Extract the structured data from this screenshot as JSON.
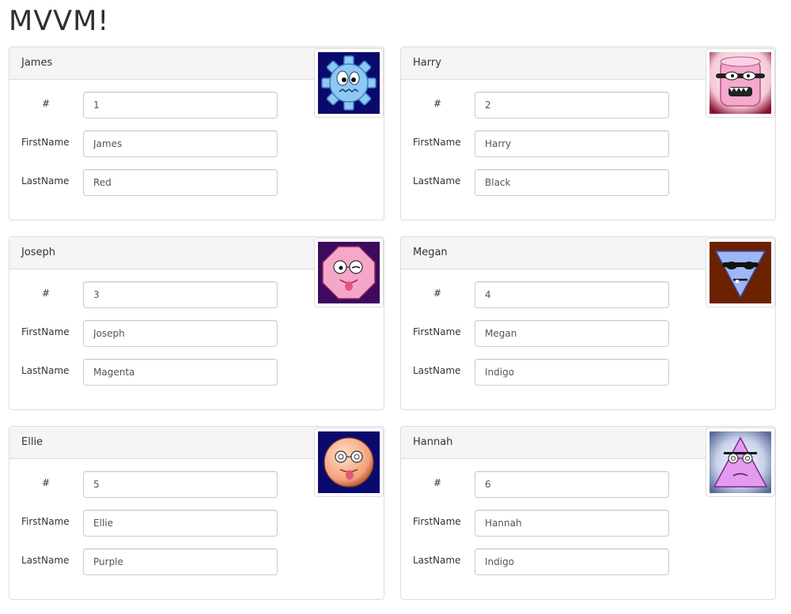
{
  "page": {
    "title": "MVVM!"
  },
  "labels": {
    "id": "#",
    "first": "FirstName",
    "last": "LastName"
  },
  "people": [
    {
      "header": "James",
      "id": "1",
      "first": "James",
      "last": "Red",
      "avatar": "blue-gear-monster-icon"
    },
    {
      "header": "Harry",
      "id": "2",
      "first": "Harry",
      "last": "Black",
      "avatar": "pink-cylinder-monster-icon"
    },
    {
      "header": "Joseph",
      "id": "3",
      "first": "Joseph",
      "last": "Magenta",
      "avatar": "pink-octagon-monster-icon"
    },
    {
      "header": "Megan",
      "id": "4",
      "first": "Megan",
      "last": "Indigo",
      "avatar": "blue-triangle-monster-icon"
    },
    {
      "header": "Ellie",
      "id": "5",
      "first": "Ellie",
      "last": "Purple",
      "avatar": "peach-circle-monster-icon"
    },
    {
      "header": "Hannah",
      "id": "6",
      "first": "Hannah",
      "last": "Indigo",
      "avatar": "violet-triangle-monster-icon"
    }
  ]
}
